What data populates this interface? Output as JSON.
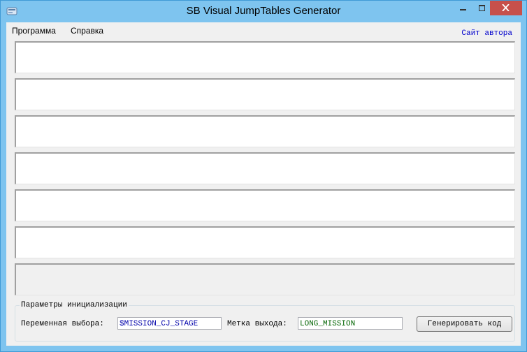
{
  "window": {
    "title": "SB Visual JumpTables Generator"
  },
  "menu": {
    "items": [
      "Программа",
      "Справка"
    ],
    "author_link": "Сайт автора"
  },
  "text_areas": [
    {
      "enabled": true,
      "value": ""
    },
    {
      "enabled": true,
      "value": ""
    },
    {
      "enabled": true,
      "value": ""
    },
    {
      "enabled": true,
      "value": ""
    },
    {
      "enabled": true,
      "value": ""
    },
    {
      "enabled": true,
      "value": ""
    },
    {
      "enabled": false,
      "value": ""
    }
  ],
  "init_params": {
    "group_title": "Параметры инициализации",
    "selection_var_label": "Переменная выбора:",
    "selection_var_value": "$MISSION_CJ_STAGE",
    "exit_label_label": "Метка выхода:",
    "exit_label_value": "LONG_MISSION",
    "generate_button": "Генерировать код"
  },
  "colors": {
    "selection_var_text": "#0000aa",
    "exit_label_text": "#006400",
    "author_link": "#0000cc",
    "title_bar": "#7ec4ef",
    "close_button": "#c7504b"
  }
}
